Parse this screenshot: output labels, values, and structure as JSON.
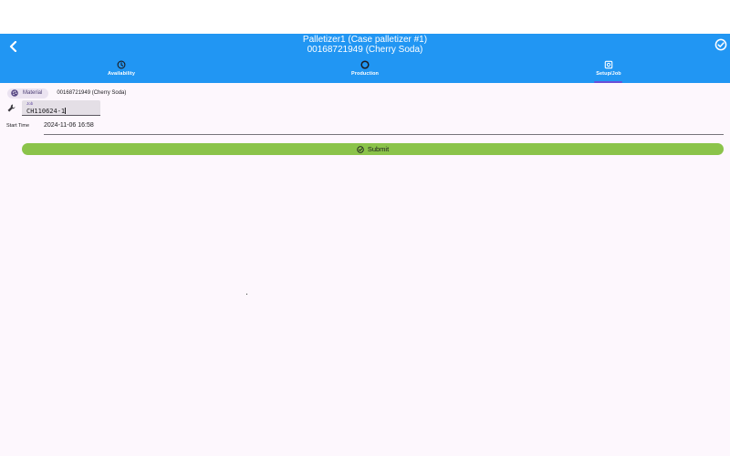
{
  "appbar": {
    "title_line1": "Palletizer1 (Case palletizer #1)",
    "title_line2": "00168721949 (Cherry Soda)",
    "back_icon": "chevron-left-icon",
    "confirm_icon": "check-circle-icon",
    "background": "#2196f3"
  },
  "tabs": [
    {
      "label": "Availability",
      "icon": "clock-icon"
    },
    {
      "label": "Production",
      "icon": "circle-icon"
    },
    {
      "label": "Setup/Job",
      "icon": "setup-icon",
      "active": true
    }
  ],
  "material": {
    "chip_label": "Material",
    "icon": "palette-icon",
    "value": "00168721949 (Cherry Soda)"
  },
  "job": {
    "label": "Job",
    "value": "CH110624-1",
    "icon": "wrench-icon"
  },
  "start_time": {
    "label": "Start Time",
    "value": "2024-11-06 16:58"
  },
  "submit": {
    "label": "Submit",
    "icon": "check-circle-icon",
    "color": "#8bc34a"
  }
}
